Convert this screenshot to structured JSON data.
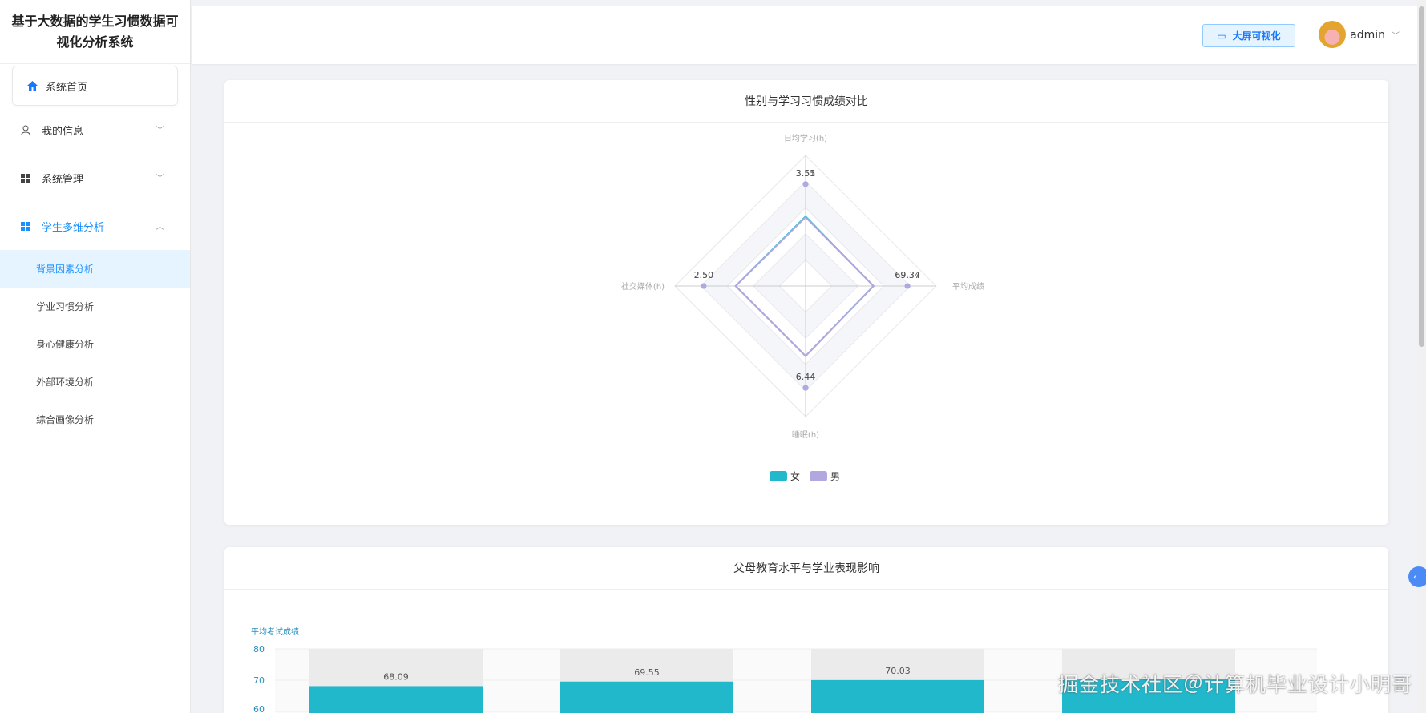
{
  "app": {
    "title": "基于大数据的学生习惯数据可视化分析系统"
  },
  "sidebar": {
    "home": "系统首页",
    "items": [
      {
        "label": "我的信息"
      },
      {
        "label": "系统管理"
      },
      {
        "label": "学生多维分析"
      }
    ],
    "sub": [
      {
        "label": "背景因素分析"
      },
      {
        "label": "学业习惯分析"
      },
      {
        "label": "身心健康分析"
      },
      {
        "label": "外部环境分析"
      },
      {
        "label": "综合画像分析"
      }
    ]
  },
  "header": {
    "bigscreen": "大屏可视化",
    "user": "admin"
  },
  "watermark": "掘金技术社区＠计算机毕业设计小明哥",
  "chart_data": [
    {
      "type": "radar",
      "title": "性别与学习习惯成绩对比",
      "indicators": [
        "日均学习(h)",
        "平均成绩",
        "睡眠(h)",
        "社交媒体(h)"
      ],
      "series": [
        {
          "name": "女",
          "color": "#22b8cc",
          "values": [
            3.55,
            69.37,
            6.44,
            2.5
          ]
        },
        {
          "name": "男",
          "color": "#b3a7e0",
          "values": [
            3.51,
            69.34,
            6.44,
            2.5
          ]
        }
      ],
      "legend": "bottom"
    },
    {
      "type": "bar",
      "title": "父母教育水平与学业表现影响",
      "ylabel": "平均考试成绩",
      "yticks": [
        80,
        70,
        60
      ],
      "ylim": [
        0,
        80
      ],
      "values": [
        68.09,
        69.55,
        70.03,
        null
      ],
      "value_labels": [
        "68.09",
        "69.55",
        "70.03",
        ""
      ],
      "color": "#22b8cc"
    }
  ]
}
